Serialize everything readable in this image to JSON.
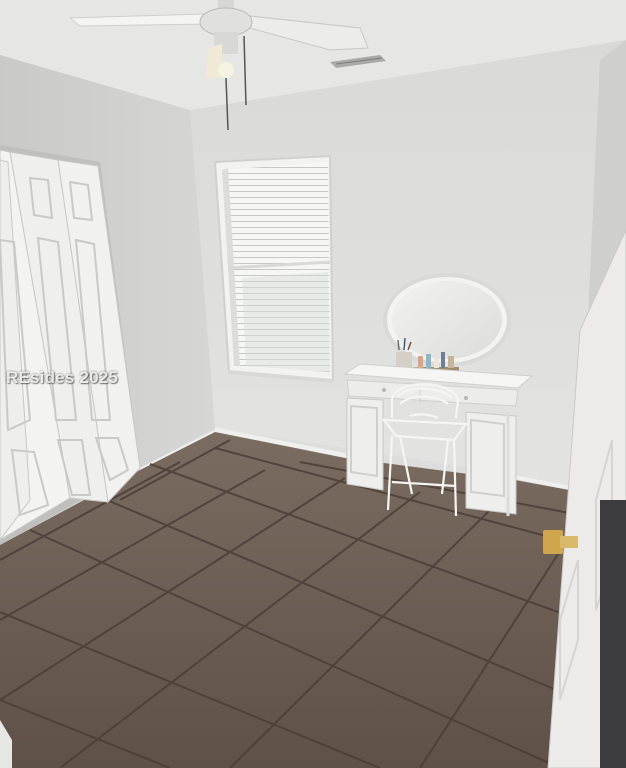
{
  "photo": {
    "watermark": "REsides 2025"
  },
  "colors": {
    "ceiling": "#e4e4e2",
    "wall_back": "#dcdcdc",
    "wall_left": "#d2d2d2",
    "floor_tile": "#6e5f55",
    "grout": "#4c4038",
    "door_white": "#f2f2f2",
    "furniture_white": "#f0f0ee"
  }
}
